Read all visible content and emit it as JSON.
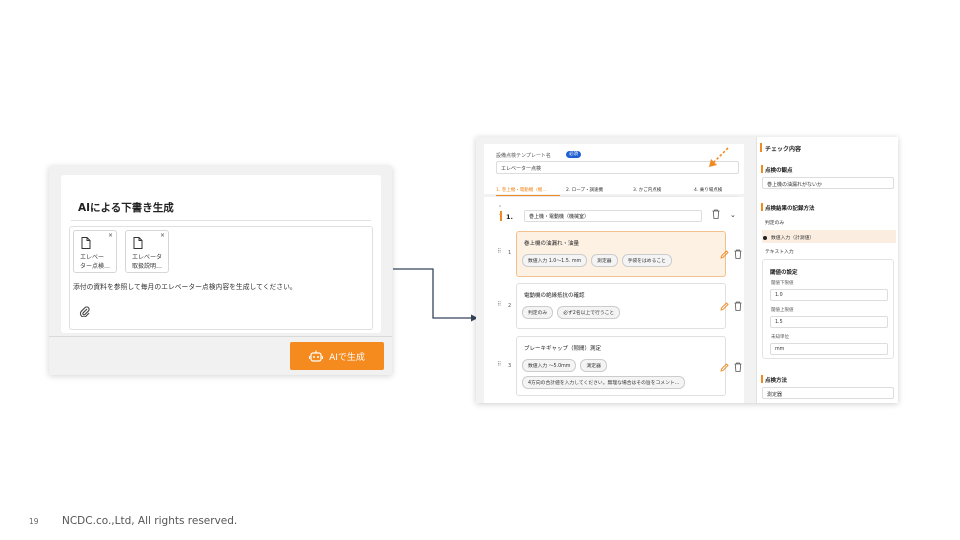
{
  "ai_dialog": {
    "title": "AIによる下書き生成",
    "attachments": [
      {
        "name": "エレベー\nター点検…",
        "remove": "×"
      },
      {
        "name": "エレベータ\n取扱説明…",
        "remove": "×"
      }
    ],
    "prompt": "添付の資料を参照して毎月のエレベーター点検内容を生成してください。",
    "generate_label": "AIで生成"
  },
  "editor": {
    "template_label": "設備点検テンプレート名",
    "required_badge": "必須",
    "template_name": "エレベーター点検",
    "tabs": [
      "1. 巻上機・電動機（機…",
      "2. ロープ・調速機",
      "3. かご内点検",
      "4. 乗り場点検"
    ],
    "section": {
      "number": "1.",
      "name": "巻上機・電動機（機械室）"
    },
    "items": [
      {
        "num": "1",
        "title": "巻上機の油漏れ・油量",
        "tags": [
          "数値入力 1.0〜1.5. mm",
          "測定器",
          "手袋をはめること"
        ]
      },
      {
        "num": "2",
        "title": "電動機の絶縁抵抗の確認",
        "tags": [
          "判定のみ",
          "必ず2名以上で行うこと"
        ]
      },
      {
        "num": "3",
        "title": "ブレーキギャップ（隙間）測定",
        "tags": [
          "数値入力 〜5.0mm",
          "測定器",
          "4方向の合計値を入力してください。無理な場合はその旨をコメント…"
        ]
      }
    ]
  },
  "panel": {
    "title": "チェック内容",
    "viewpoint_heading": "点検の観点",
    "viewpoint_value": "巻上機の油漏れがないか",
    "method_heading": "点検結果の記録方法",
    "options": [
      "判定のみ",
      "数値入力（計測値）",
      "テキスト入力"
    ],
    "selected_option_index": 1,
    "threshold_heading": "閾値の設定",
    "lower_label": "閾値下限値",
    "lower_value": "1.0",
    "upper_label": "閾値上限値",
    "upper_value": "1.5",
    "unit_label": "未知単位",
    "unit_value": "mm",
    "inspect_method_heading": "点検方法",
    "inspect_method_value": "測定器"
  },
  "footer": {
    "page_number": "19",
    "copyright": "NCDC.co.,Ltd, All rights reserved."
  },
  "colors": {
    "accent": "#f58a1f",
    "badge": "#1e5fd1"
  }
}
